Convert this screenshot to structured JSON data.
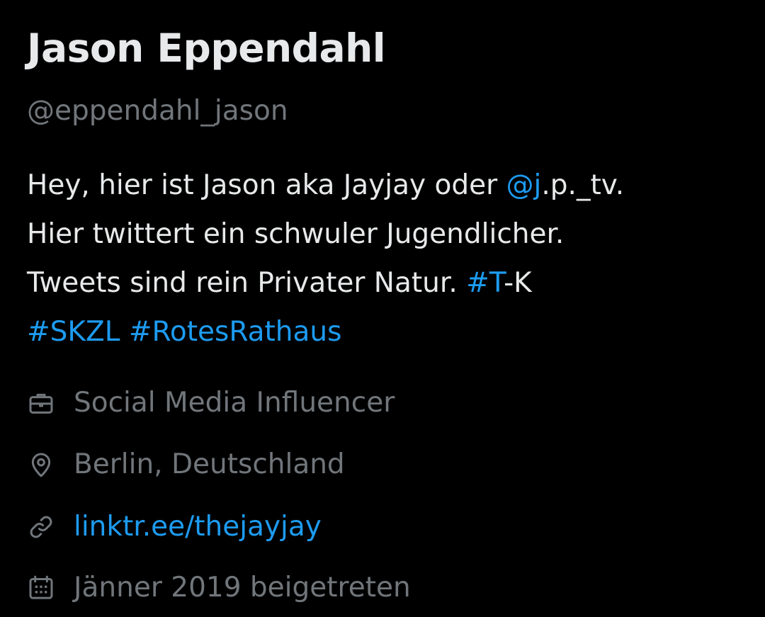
{
  "colors": {
    "background": "#000000",
    "primary_text": "#e7e9ea",
    "secondary_text": "#71767b",
    "accent": "#1d9bf0"
  },
  "profile": {
    "display_name": "Jason Eppendahl",
    "handle": "@eppendahl_jason",
    "bio": {
      "line1": {
        "text": "Hey, hier ist Jason aka Jayjay oder ",
        "mention": "@j",
        "after": ".p._tv."
      },
      "line2": "Hier twittert ein schwuler Jugendlicher.",
      "line3": {
        "text": "Tweets sind rein Privater Natur. ",
        "hashtag": "#T",
        "after": "-K"
      },
      "line4": {
        "hashtag1": "#SKZL",
        "hashtag2": "#RotesRathaus"
      }
    },
    "meta": {
      "profession": {
        "icon": "briefcase-icon",
        "text": "Social Media Influencer"
      },
      "location": {
        "icon": "location-pin-icon",
        "text": "Berlin, Deutschland"
      },
      "website": {
        "icon": "link-icon",
        "text": "linktr.ee/thejayjay"
      },
      "joined": {
        "icon": "calendar-icon",
        "text": "Jänner 2019 beigetreten"
      }
    }
  }
}
